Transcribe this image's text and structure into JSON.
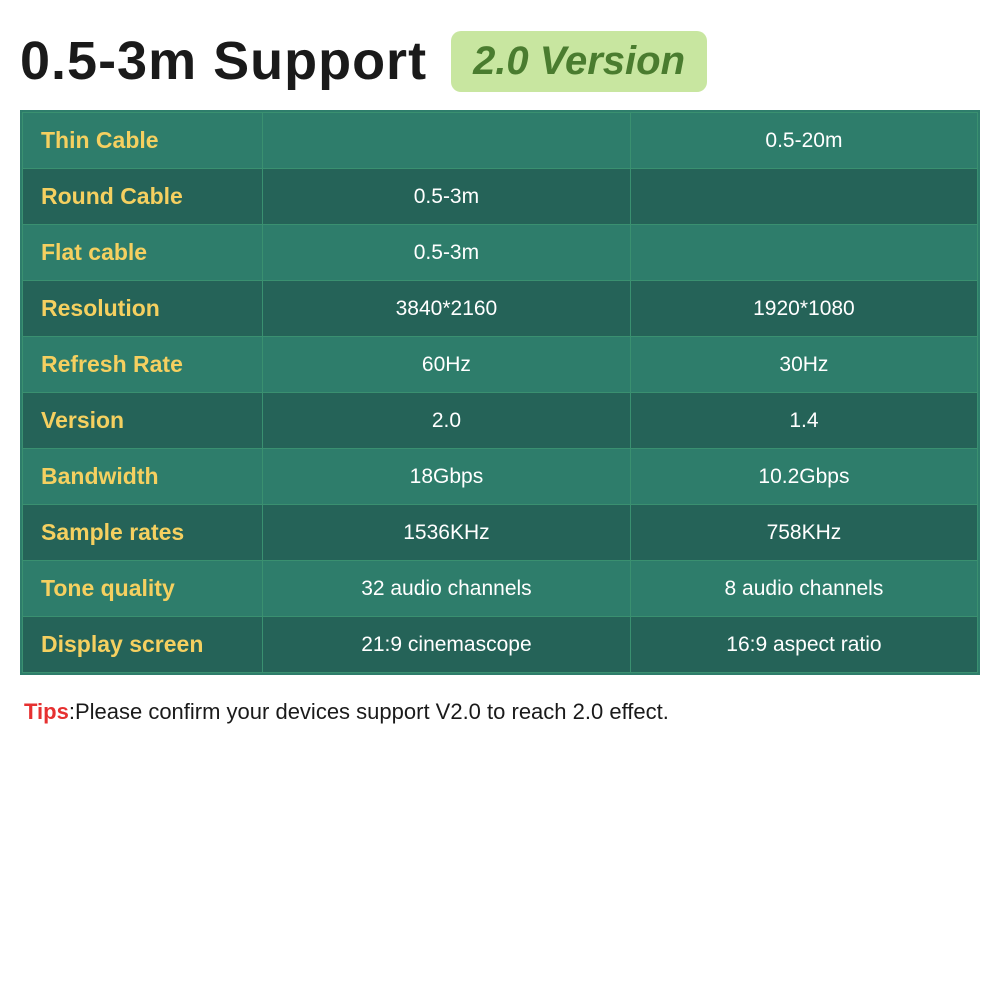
{
  "header": {
    "main_title": "0.5-3m Support",
    "version_badge": "2.0 Version"
  },
  "table": {
    "rows": [
      {
        "label": "Thin Cable",
        "col1": "",
        "col2": "0.5-20m"
      },
      {
        "label": "Round Cable",
        "col1": "0.5-3m",
        "col2": ""
      },
      {
        "label": "Flat cable",
        "col1": "0.5-3m",
        "col2": ""
      },
      {
        "label": "Resolution",
        "col1": "3840*2160",
        "col2": "1920*1080"
      },
      {
        "label": "Refresh Rate",
        "col1": "60Hz",
        "col2": "30Hz"
      },
      {
        "label": "Version",
        "col1": "2.0",
        "col2": "1.4"
      },
      {
        "label": "Bandwidth",
        "col1": "18Gbps",
        "col2": "10.2Gbps"
      },
      {
        "label": "Sample rates",
        "col1": "1536KHz",
        "col2": "758KHz"
      },
      {
        "label": "Tone quality",
        "col1": "32 audio channels",
        "col2": "8 audio channels"
      },
      {
        "label": "Display screen",
        "col1": "21:9 cinemascope",
        "col2": "16:9 aspect ratio"
      }
    ]
  },
  "tips": {
    "label": "Tips",
    "text": ":Please confirm your devices support V2.0 to reach 2.0 effect."
  }
}
